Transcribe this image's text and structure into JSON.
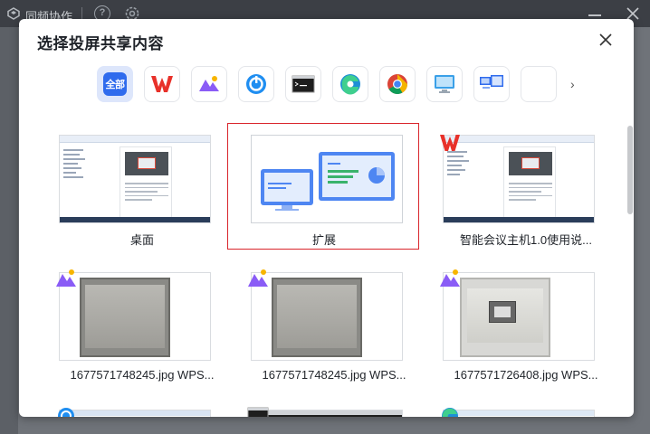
{
  "background_window": {
    "title": "同频协作",
    "help_glyph": "?"
  },
  "dialog": {
    "title": "选择投屏共享内容",
    "next_glyph": "›"
  },
  "app_filters": [
    {
      "name": "all",
      "label": "全部",
      "selected": true
    },
    {
      "name": "wps",
      "icon": "wps-icon"
    },
    {
      "name": "image-viewer",
      "icon": "image-viewer-icon"
    },
    {
      "name": "meeting-app",
      "icon": "meeting-app-icon"
    },
    {
      "name": "terminal",
      "icon": "terminal-icon"
    },
    {
      "name": "edge",
      "icon": "edge-browser-icon"
    },
    {
      "name": "chrome",
      "icon": "chrome-browser-icon"
    },
    {
      "name": "remote-desktop",
      "icon": "remote-desktop-icon"
    },
    {
      "name": "screen-share",
      "icon": "screen-share-icon"
    },
    {
      "name": "blank",
      "icon": "blank-app-icon"
    }
  ],
  "tiles": [
    {
      "label": "桌面",
      "kind": "desktop"
    },
    {
      "label": "扩展",
      "kind": "extend",
      "selected": true
    },
    {
      "label": "智能会议主机1.0使用说...",
      "kind": "wps-doc"
    },
    {
      "label": "1677571748245.jpg WPS...",
      "kind": "photo"
    },
    {
      "label": "1677571748245.jpg WPS...",
      "kind": "photo"
    },
    {
      "label": "1677571726408.jpg WPS...",
      "kind": "photo"
    }
  ],
  "colors": {
    "accent": "#2f6bed",
    "selected_border": "#d9252b",
    "wps_red": "#e8312a"
  }
}
